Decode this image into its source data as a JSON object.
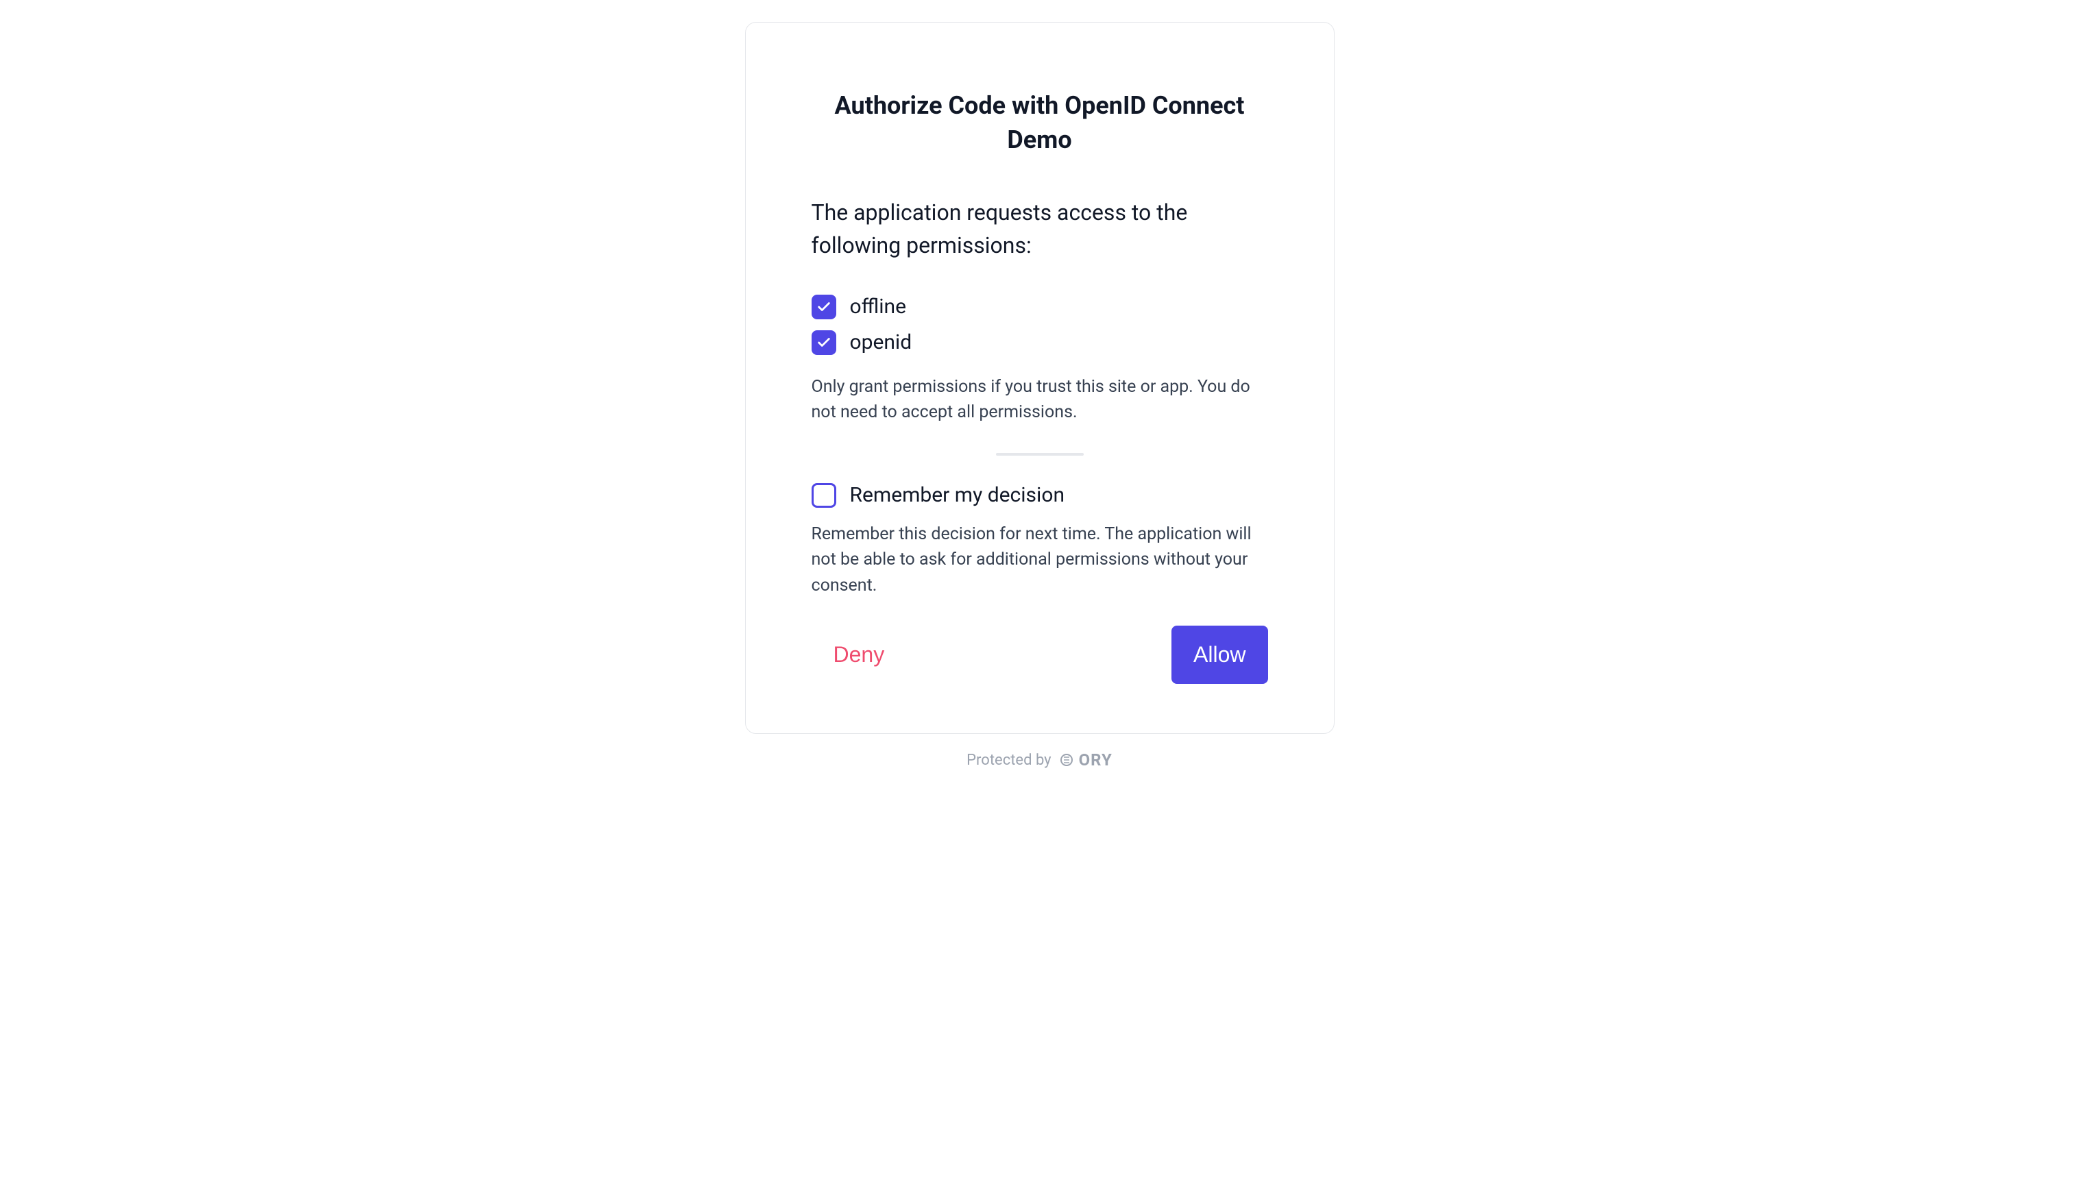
{
  "title": "Authorize Code with OpenID Connect Demo",
  "description": "The application requests access to the following permissions:",
  "permissions": [
    {
      "label": "offline",
      "checked": true
    },
    {
      "label": "openid",
      "checked": true
    }
  ],
  "helper_text": "Only grant permissions if you trust this site or app. You do not need to accept all permissions.",
  "remember": {
    "label": "Remember my decision",
    "checked": false,
    "helper": "Remember this decision for next time. The application will not be able to ask for additional permissions without your consent."
  },
  "buttons": {
    "deny": "Deny",
    "allow": "Allow"
  },
  "footer": {
    "protected_by": "Protected by",
    "brand": "ORY"
  }
}
